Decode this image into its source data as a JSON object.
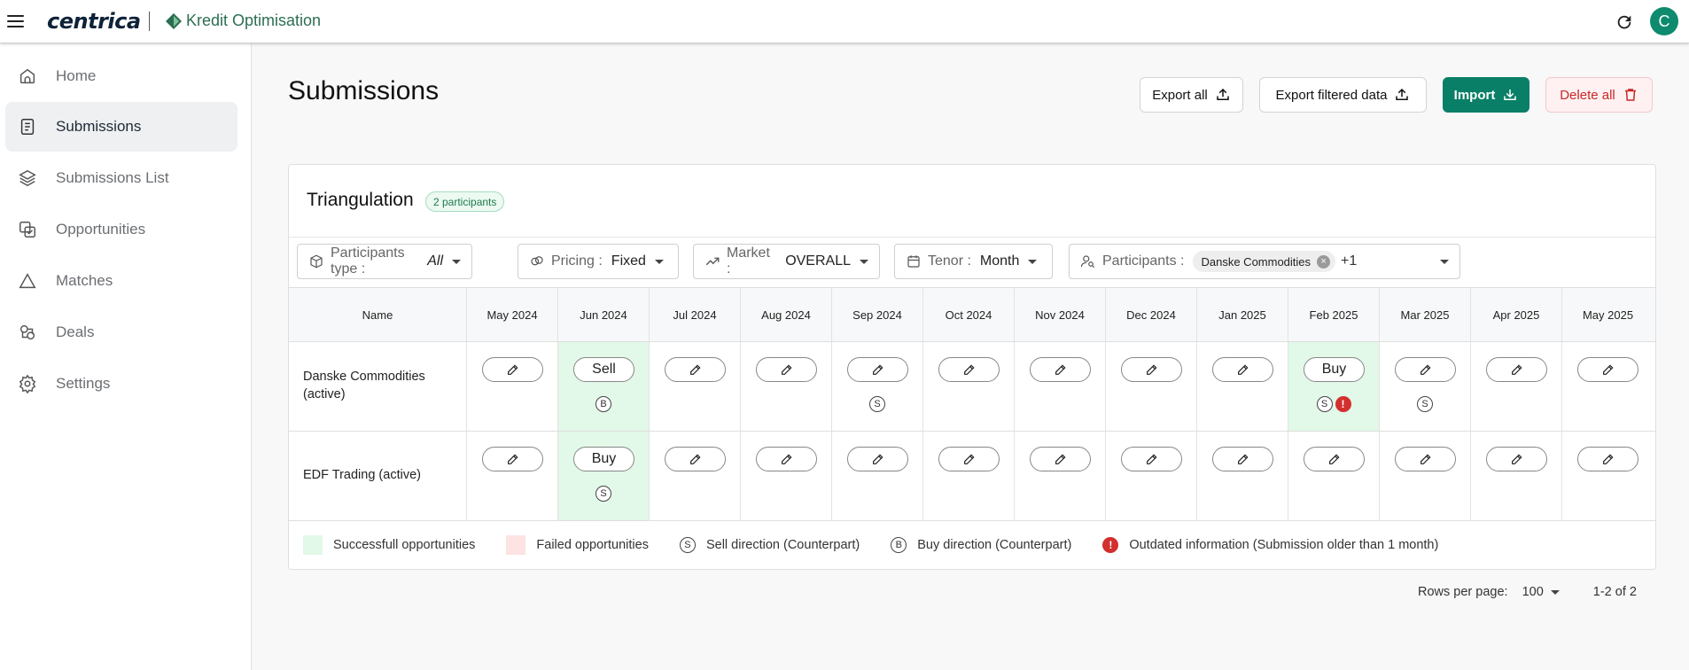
{
  "topbar": {
    "brand": "centrica",
    "app_name": "Kredit Optimisation",
    "avatar_initial": "C"
  },
  "sidebar": {
    "items": [
      {
        "label": "Home",
        "icon": "home-icon",
        "active": false
      },
      {
        "label": "Submissions",
        "icon": "document-icon",
        "active": true
      },
      {
        "label": "Submissions List",
        "icon": "layers-icon",
        "active": false
      },
      {
        "label": "Opportunities",
        "icon": "opportunities-icon",
        "active": false
      },
      {
        "label": "Matches",
        "icon": "triangle-icon",
        "active": false
      },
      {
        "label": "Deals",
        "icon": "deals-icon",
        "active": false
      },
      {
        "label": "Settings",
        "icon": "gear-icon",
        "active": false
      }
    ]
  },
  "header": {
    "title": "Submissions",
    "export_all": "Export all",
    "export_filtered": "Export filtered data",
    "import": "Import",
    "delete_all": "Delete all"
  },
  "card": {
    "title": "Triangulation",
    "badge": "2 participants"
  },
  "filters": {
    "participants_type": {
      "label": "Participants type :",
      "value": "All"
    },
    "pricing": {
      "label": "Pricing :",
      "value": "Fixed"
    },
    "market": {
      "label": "Market :",
      "value": "OVERALL"
    },
    "tenor": {
      "label": "Tenor :",
      "value": "Month"
    },
    "participants": {
      "label": "Participants :",
      "chip": "Danske Commodities",
      "more": "+1"
    }
  },
  "table": {
    "name_header": "Name",
    "months": [
      "May 2024",
      "Jun 2024",
      "Jul 2024",
      "Aug 2024",
      "Sep 2024",
      "Oct 2024",
      "Nov 2024",
      "Dec 2024",
      "Jan 2025",
      "Feb 2025",
      "Mar 2025",
      "Apr 2025",
      "May 2025"
    ],
    "rows": [
      {
        "name": "Danske Commodities (active)",
        "cells": [
          {
            "label": "",
            "indicators": [],
            "success": false
          },
          {
            "label": "Sell",
            "indicators": [
              "B"
            ],
            "success": true
          },
          {
            "label": "",
            "indicators": [],
            "success": false
          },
          {
            "label": "",
            "indicators": [],
            "success": false
          },
          {
            "label": "",
            "indicators": [
              "S"
            ],
            "success": false
          },
          {
            "label": "",
            "indicators": [],
            "success": false
          },
          {
            "label": "",
            "indicators": [],
            "success": false
          },
          {
            "label": "",
            "indicators": [],
            "success": false
          },
          {
            "label": "",
            "indicators": [],
            "success": false
          },
          {
            "label": "Buy",
            "indicators": [
              "S",
              "!"
            ],
            "success": true
          },
          {
            "label": "",
            "indicators": [
              "S"
            ],
            "success": false
          },
          {
            "label": "",
            "indicators": [],
            "success": false
          },
          {
            "label": "",
            "indicators": [],
            "success": false
          }
        ]
      },
      {
        "name": "EDF Trading (active)",
        "cells": [
          {
            "label": "",
            "indicators": [],
            "success": false
          },
          {
            "label": "Buy",
            "indicators": [
              "S"
            ],
            "success": true
          },
          {
            "label": "",
            "indicators": [],
            "success": false
          },
          {
            "label": "",
            "indicators": [],
            "success": false
          },
          {
            "label": "",
            "indicators": [],
            "success": false
          },
          {
            "label": "",
            "indicators": [],
            "success": false
          },
          {
            "label": "",
            "indicators": [],
            "success": false
          },
          {
            "label": "",
            "indicators": [],
            "success": false
          },
          {
            "label": "",
            "indicators": [],
            "success": false
          },
          {
            "label": "",
            "indicators": [],
            "success": false
          },
          {
            "label": "",
            "indicators": [],
            "success": false
          },
          {
            "label": "",
            "indicators": [],
            "success": false
          },
          {
            "label": "",
            "indicators": [],
            "success": false
          }
        ]
      }
    ]
  },
  "legend": {
    "successful": "Successfull opportunities",
    "failed": "Failed opportunities",
    "sell_symbol": "S",
    "sell": "Sell direction (Counterpart)",
    "buy_symbol": "B",
    "buy": "Buy direction (Counterpart)",
    "outdated_symbol": "!",
    "outdated": "Outdated information (Submission older than 1 month)"
  },
  "pagination": {
    "rows_per_page_label": "Rows per page:",
    "rows_per_page": "100",
    "range": "1-2 of 2"
  },
  "colors": {
    "accent": "#0a7f68",
    "success_bg": "#e2f8e8",
    "failed_bg": "#fde3e3",
    "danger": "#d32f2f"
  }
}
